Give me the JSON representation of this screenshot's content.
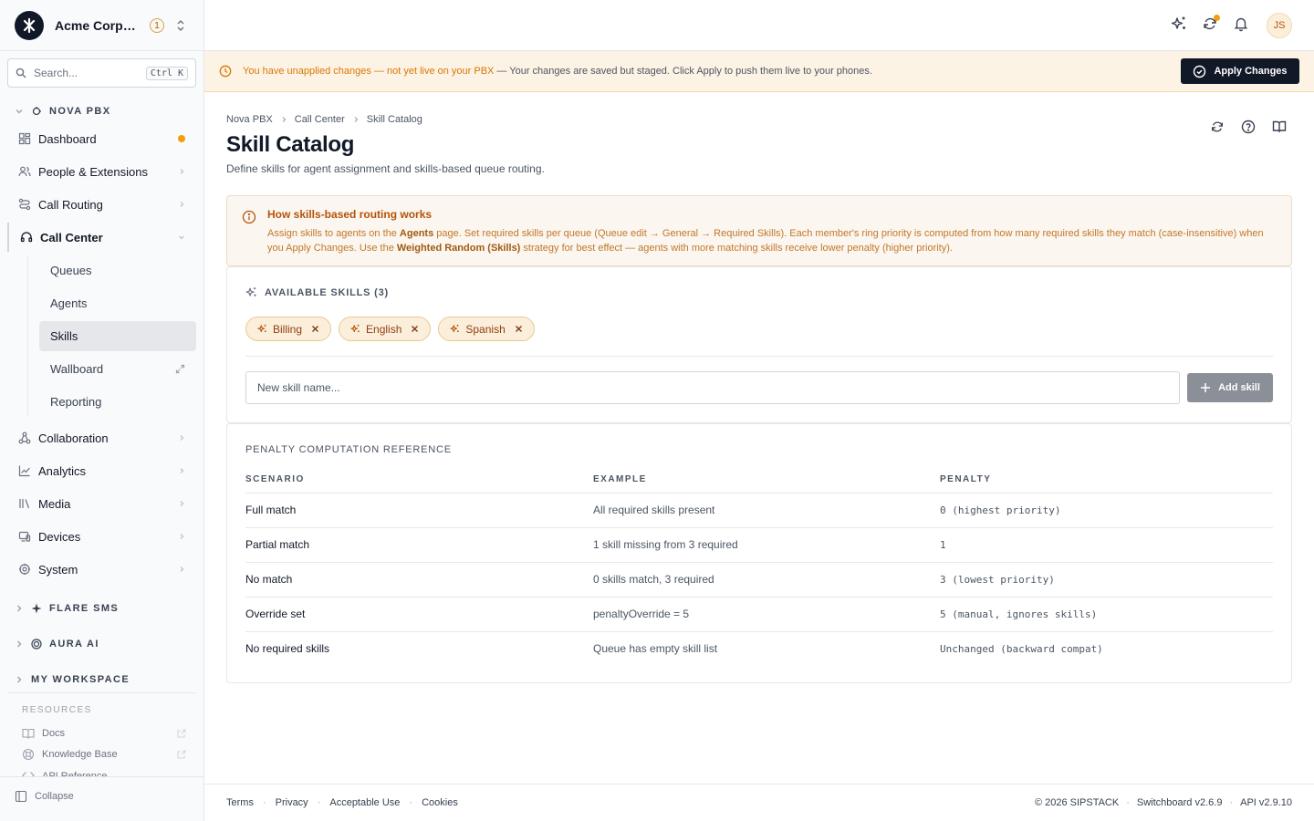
{
  "org": {
    "name": "Acme Corporation",
    "badge": "1"
  },
  "search": {
    "placeholder": "Search...",
    "shortcut": "Ctrl K"
  },
  "sidebar": {
    "section_nova": "NOVA PBX",
    "items": [
      {
        "label": "Dashboard"
      },
      {
        "label": "People & Extensions"
      },
      {
        "label": "Call Routing"
      },
      {
        "label": "Call Center"
      },
      {
        "label": "Collaboration"
      },
      {
        "label": "Analytics"
      },
      {
        "label": "Media"
      },
      {
        "label": "Devices"
      },
      {
        "label": "System"
      }
    ],
    "call_center_sub": [
      {
        "label": "Queues"
      },
      {
        "label": "Agents"
      },
      {
        "label": "Skills"
      },
      {
        "label": "Wallboard"
      },
      {
        "label": "Reporting"
      }
    ],
    "section_flare": "FLARE SMS",
    "section_aura": "AURA AI",
    "section_workspace": "MY WORKSPACE",
    "resources_title": "RESOURCES",
    "resources": [
      {
        "label": "Docs"
      },
      {
        "label": "Knowledge Base"
      },
      {
        "label": "API Reference"
      }
    ],
    "collapse": "Collapse"
  },
  "topbar": {
    "avatar": "JS"
  },
  "banner": {
    "strong": "You have unapplied changes — not yet live on your PBX",
    "rest": "— Your changes are saved but staged. Click Apply to push them live to your phones.",
    "button": "Apply Changes"
  },
  "breadcrumb": [
    "Nova PBX",
    "Call Center",
    "Skill Catalog"
  ],
  "page": {
    "title": "Skill Catalog",
    "subtitle": "Define skills for agent assignment and skills-based queue routing."
  },
  "info": {
    "title": "How skills-based routing works",
    "p1": "Assign skills to agents on the ",
    "agents": "Agents",
    "p2": " page. Set required skills per queue (Queue edit → General → Required Skills). Each member's ring priority is computed from how many required skills they match (case-insensitive) when you Apply Changes. Use the ",
    "strategy": "Weighted Random (Skills)",
    "p3": " strategy for best effect — agents with more matching skills receive lower penalty (higher priority)."
  },
  "skills": {
    "header": "AVAILABLE SKILLS (3)",
    "chips": [
      "Billing",
      "English",
      "Spanish"
    ],
    "input_placeholder": "New skill name...",
    "add_button": "Add skill"
  },
  "reference": {
    "title": "PENALTY COMPUTATION REFERENCE",
    "columns": [
      "SCENARIO",
      "EXAMPLE",
      "PENALTY"
    ],
    "rows": [
      [
        "Full match",
        "All required skills present",
        "0 (highest priority)"
      ],
      [
        "Partial match",
        "1 skill missing from 3 required",
        "1"
      ],
      [
        "No match",
        "0 skills match, 3 required",
        "3 (lowest priority)"
      ],
      [
        "Override set",
        "penaltyOverride = 5",
        "5 (manual, ignores skills)"
      ],
      [
        "No required skills",
        "Queue has empty skill list",
        "Unchanged (backward compat)"
      ]
    ]
  },
  "footer": {
    "links": [
      "Terms",
      "Privacy",
      "Acceptable Use",
      "Cookies"
    ],
    "copyright": "© 2026 SIPSTACK",
    "switchboard": "Switchboard v2.6.9",
    "api": "API v2.9.10"
  },
  "colors": {
    "accent": "#d97706",
    "dark": "#111827",
    "chip_bg": "#fbefdc",
    "status_dot": "#f59e0b"
  }
}
